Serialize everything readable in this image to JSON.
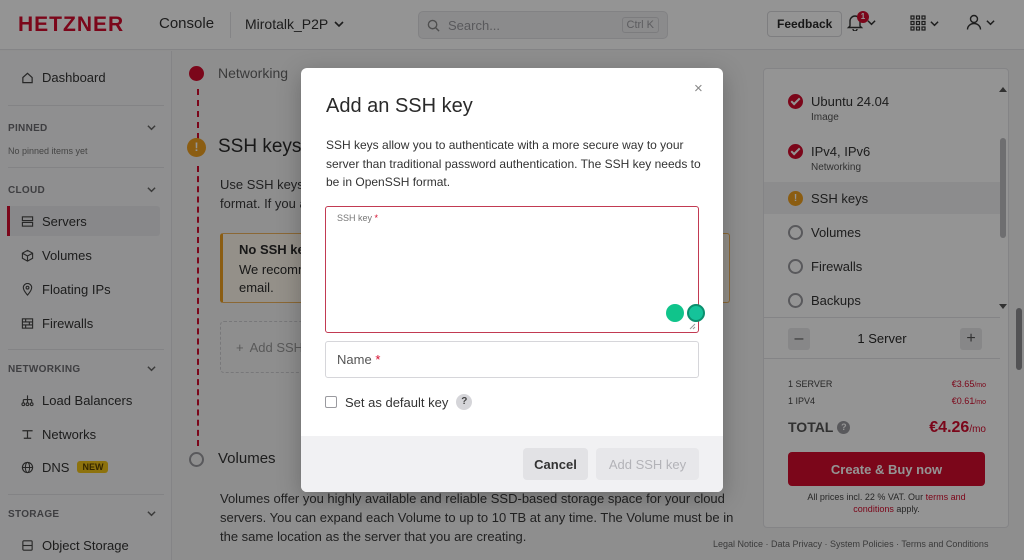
{
  "brand": {
    "logo": "HETZNER",
    "console": "Console",
    "accent": "#d50c2d"
  },
  "header": {
    "project": "Mirotalk_P2P",
    "search_placeholder": "Search...",
    "search_shortcut": "Ctrl K",
    "feedback": "Feedback",
    "notifications_count": "1"
  },
  "sidebar": {
    "dashboard": "Dashboard",
    "pinned_label": "PINNED",
    "no_pinned": "No pinned items yet",
    "cloud_label": "CLOUD",
    "servers": "Servers",
    "volumes": "Volumes",
    "floating_ips": "Floating IPs",
    "firewalls": "Firewalls",
    "networking_label": "NETWORKING",
    "load_balancers": "Load Balancers",
    "networks": "Networks",
    "dns": "DNS",
    "dns_badge": "NEW",
    "storage_label": "STORAGE",
    "object_storage": "Object Storage"
  },
  "main": {
    "networking_title": "Networking",
    "ssh_title": "SSH keys",
    "ssh_desc_1": "Use SSH keys",
    "ssh_desc_2": "format. If you a",
    "warn_title": "No SSH ke",
    "warn_text_1": "We recomm",
    "warn_text_2": "email.",
    "add_ssh": "Add SSH",
    "volumes_title": "Volumes",
    "volumes_desc": [
      "Volumes offer you highly available and reliable SSD-based storage space for your cloud",
      "servers. You can expand each Volume to up to 10 TB at any time. The Volume must be in",
      "the same location as the server that you are creating."
    ]
  },
  "summary": {
    "steps": [
      {
        "title": "Ubuntu 24.04",
        "sub": "Image",
        "state": "done"
      },
      {
        "title": "IPv4, IPv6",
        "sub": "Networking",
        "state": "done"
      },
      {
        "title": "SSH keys",
        "sub": "",
        "state": "warn"
      },
      {
        "title": "Volumes",
        "sub": "",
        "state": "todo"
      },
      {
        "title": "Firewalls",
        "sub": "",
        "state": "todo"
      },
      {
        "title": "Backups",
        "sub": "",
        "state": "todo"
      }
    ],
    "server_count": "1 Server",
    "minus": "–",
    "plus": "+",
    "line1_label": "1 SERVER",
    "line1_value": "€3.65",
    "line2_label": "1 IPV4",
    "line2_value": "€0.61",
    "per_month": "/mo",
    "total_label": "TOTAL",
    "total_value": "€4.26",
    "buy_button": "Create & Buy now",
    "vat_text": "All prices incl. 22 % VAT. Our",
    "vat_link1": "terms and conditions",
    "vat_text2": "apply."
  },
  "footer": {
    "text": "Legal Notice · Data Privacy · System Policies · Terms and Conditions"
  },
  "modal": {
    "title": "Add an SSH key",
    "close": "×",
    "description": "SSH keys allow you to authenticate with a more secure way to your server than traditional password authentication. The SSH key needs to be in OpenSSH format.",
    "ssh_key_label": "SSH key",
    "required_mark": "*",
    "name_placeholder": "Name",
    "default_key_label": "Set as default key",
    "help": "?",
    "cancel": "Cancel",
    "add_button": "Add SSH key"
  }
}
